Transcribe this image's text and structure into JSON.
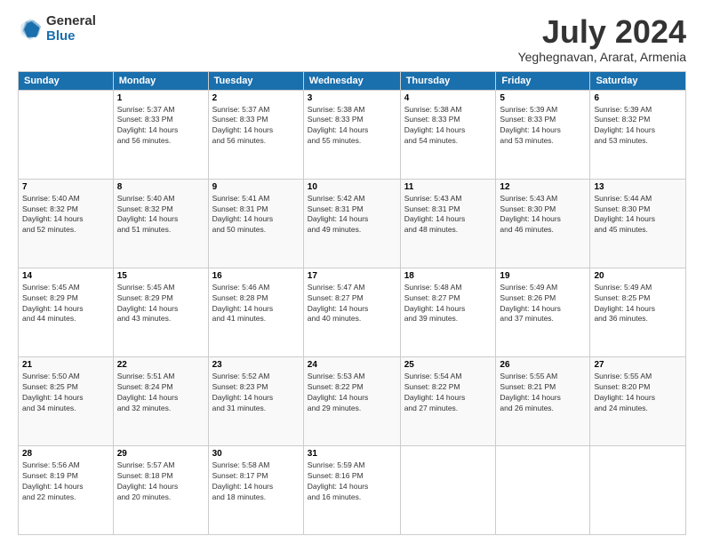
{
  "logo": {
    "general": "General",
    "blue": "Blue"
  },
  "title": "July 2024",
  "location": "Yeghegnavan, Ararat, Armenia",
  "days_header": [
    "Sunday",
    "Monday",
    "Tuesday",
    "Wednesday",
    "Thursday",
    "Friday",
    "Saturday"
  ],
  "weeks": [
    [
      {
        "num": "",
        "info": ""
      },
      {
        "num": "1",
        "info": "Sunrise: 5:37 AM\nSunset: 8:33 PM\nDaylight: 14 hours\nand 56 minutes."
      },
      {
        "num": "2",
        "info": "Sunrise: 5:37 AM\nSunset: 8:33 PM\nDaylight: 14 hours\nand 56 minutes."
      },
      {
        "num": "3",
        "info": "Sunrise: 5:38 AM\nSunset: 8:33 PM\nDaylight: 14 hours\nand 55 minutes."
      },
      {
        "num": "4",
        "info": "Sunrise: 5:38 AM\nSunset: 8:33 PM\nDaylight: 14 hours\nand 54 minutes."
      },
      {
        "num": "5",
        "info": "Sunrise: 5:39 AM\nSunset: 8:33 PM\nDaylight: 14 hours\nand 53 minutes."
      },
      {
        "num": "6",
        "info": "Sunrise: 5:39 AM\nSunset: 8:32 PM\nDaylight: 14 hours\nand 53 minutes."
      }
    ],
    [
      {
        "num": "7",
        "info": "Sunrise: 5:40 AM\nSunset: 8:32 PM\nDaylight: 14 hours\nand 52 minutes."
      },
      {
        "num": "8",
        "info": "Sunrise: 5:40 AM\nSunset: 8:32 PM\nDaylight: 14 hours\nand 51 minutes."
      },
      {
        "num": "9",
        "info": "Sunrise: 5:41 AM\nSunset: 8:31 PM\nDaylight: 14 hours\nand 50 minutes."
      },
      {
        "num": "10",
        "info": "Sunrise: 5:42 AM\nSunset: 8:31 PM\nDaylight: 14 hours\nand 49 minutes."
      },
      {
        "num": "11",
        "info": "Sunrise: 5:43 AM\nSunset: 8:31 PM\nDaylight: 14 hours\nand 48 minutes."
      },
      {
        "num": "12",
        "info": "Sunrise: 5:43 AM\nSunset: 8:30 PM\nDaylight: 14 hours\nand 46 minutes."
      },
      {
        "num": "13",
        "info": "Sunrise: 5:44 AM\nSunset: 8:30 PM\nDaylight: 14 hours\nand 45 minutes."
      }
    ],
    [
      {
        "num": "14",
        "info": "Sunrise: 5:45 AM\nSunset: 8:29 PM\nDaylight: 14 hours\nand 44 minutes."
      },
      {
        "num": "15",
        "info": "Sunrise: 5:45 AM\nSunset: 8:29 PM\nDaylight: 14 hours\nand 43 minutes."
      },
      {
        "num": "16",
        "info": "Sunrise: 5:46 AM\nSunset: 8:28 PM\nDaylight: 14 hours\nand 41 minutes."
      },
      {
        "num": "17",
        "info": "Sunrise: 5:47 AM\nSunset: 8:27 PM\nDaylight: 14 hours\nand 40 minutes."
      },
      {
        "num": "18",
        "info": "Sunrise: 5:48 AM\nSunset: 8:27 PM\nDaylight: 14 hours\nand 39 minutes."
      },
      {
        "num": "19",
        "info": "Sunrise: 5:49 AM\nSunset: 8:26 PM\nDaylight: 14 hours\nand 37 minutes."
      },
      {
        "num": "20",
        "info": "Sunrise: 5:49 AM\nSunset: 8:25 PM\nDaylight: 14 hours\nand 36 minutes."
      }
    ],
    [
      {
        "num": "21",
        "info": "Sunrise: 5:50 AM\nSunset: 8:25 PM\nDaylight: 14 hours\nand 34 minutes."
      },
      {
        "num": "22",
        "info": "Sunrise: 5:51 AM\nSunset: 8:24 PM\nDaylight: 14 hours\nand 32 minutes."
      },
      {
        "num": "23",
        "info": "Sunrise: 5:52 AM\nSunset: 8:23 PM\nDaylight: 14 hours\nand 31 minutes."
      },
      {
        "num": "24",
        "info": "Sunrise: 5:53 AM\nSunset: 8:22 PM\nDaylight: 14 hours\nand 29 minutes."
      },
      {
        "num": "25",
        "info": "Sunrise: 5:54 AM\nSunset: 8:22 PM\nDaylight: 14 hours\nand 27 minutes."
      },
      {
        "num": "26",
        "info": "Sunrise: 5:55 AM\nSunset: 8:21 PM\nDaylight: 14 hours\nand 26 minutes."
      },
      {
        "num": "27",
        "info": "Sunrise: 5:55 AM\nSunset: 8:20 PM\nDaylight: 14 hours\nand 24 minutes."
      }
    ],
    [
      {
        "num": "28",
        "info": "Sunrise: 5:56 AM\nSunset: 8:19 PM\nDaylight: 14 hours\nand 22 minutes."
      },
      {
        "num": "29",
        "info": "Sunrise: 5:57 AM\nSunset: 8:18 PM\nDaylight: 14 hours\nand 20 minutes."
      },
      {
        "num": "30",
        "info": "Sunrise: 5:58 AM\nSunset: 8:17 PM\nDaylight: 14 hours\nand 18 minutes."
      },
      {
        "num": "31",
        "info": "Sunrise: 5:59 AM\nSunset: 8:16 PM\nDaylight: 14 hours\nand 16 minutes."
      },
      {
        "num": "",
        "info": ""
      },
      {
        "num": "",
        "info": ""
      },
      {
        "num": "",
        "info": ""
      }
    ]
  ]
}
